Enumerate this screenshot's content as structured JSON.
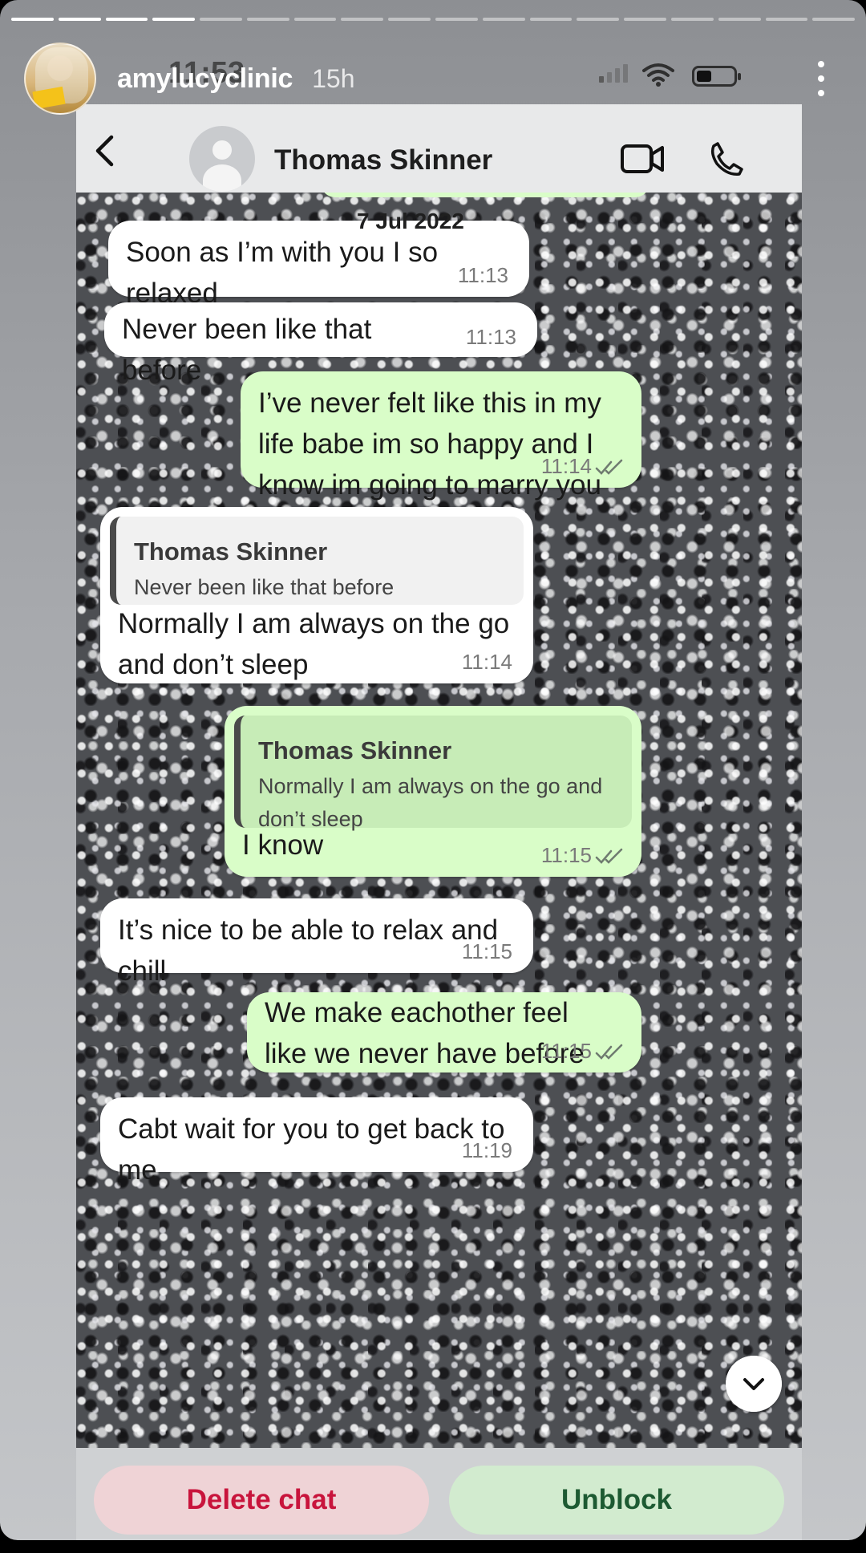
{
  "story": {
    "username": "amylucyclinic",
    "age": "15h",
    "segments_total": 18,
    "segments_done": 4
  },
  "status_bar": {
    "time": "11:53"
  },
  "chat_header": {
    "contact_name": "Thomas Skinner"
  },
  "date_chip": "7 Jul 2022",
  "messages": [
    {
      "direction": "in",
      "text": "Soon as I’m with you I so relaxed",
      "time": "11:13"
    },
    {
      "direction": "in",
      "text": "Never been like that before",
      "time": "11:13"
    },
    {
      "direction": "out",
      "text": "I’ve never felt like this in my life babe im so happy and I know im going to marry you ❤️",
      "time": "11:14",
      "read": true
    },
    {
      "direction": "in",
      "quote_name": "Thomas Skinner",
      "quote_text": "Never been like that before",
      "text": "Normally I am always on the go and don’t sleep",
      "time": "11:14"
    },
    {
      "direction": "out",
      "quote_name": "Thomas Skinner",
      "quote_text": "Normally I am always on the go and don’t sleep",
      "text": "I know",
      "time": "11:15",
      "read": true
    },
    {
      "direction": "in",
      "text": "It’s nice to be able to relax and chill",
      "time": "11:15"
    },
    {
      "direction": "out",
      "text": "We make eachother feel like we never have before",
      "time": "11:15",
      "read": true
    },
    {
      "direction": "in",
      "text": "Cabt wait for you to get back to me",
      "time": "11:19"
    }
  ],
  "actions": {
    "delete_chat": "Delete chat",
    "unblock": "Unblock"
  },
  "colors": {
    "incoming_bubble": "#ffffff",
    "outgoing_bubble": "#d9fdc8",
    "delete_text": "#c8143c",
    "unblock_text": "#1d5a32"
  },
  "icons": [
    "more-vertical-icon",
    "back-chevron-icon",
    "video-call-icon",
    "phone-call-icon",
    "double-check-icon",
    "chevron-down-icon",
    "signal-icon",
    "wifi-icon",
    "battery-icon"
  ]
}
